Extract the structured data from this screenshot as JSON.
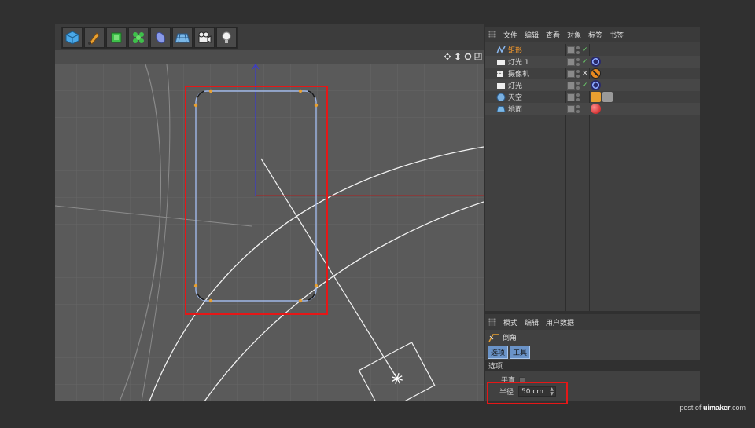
{
  "toolbar": {
    "icons": [
      "cube-icon",
      "pen-icon",
      "subdivision-icon",
      "cloner-icon",
      "deformer-icon",
      "floor-icon",
      "camera-icon",
      "light-icon"
    ]
  },
  "viewport": {
    "nav_icons": [
      "move-view-icon",
      "zoom-view-icon",
      "rotate-view-icon",
      "maximize-icon"
    ],
    "colors": {
      "spline": "#a0b8e8",
      "grid_bg": "#5a5a5a",
      "highlight": "#e51717",
      "point": "#e8a030"
    }
  },
  "object_manager": {
    "menu": [
      "文件",
      "编辑",
      "查看",
      "对象",
      "标签",
      "书签"
    ],
    "objects": [
      {
        "name": "矩形",
        "icon": "spline-icon",
        "active": true,
        "tags": []
      },
      {
        "name": "灯光 1",
        "icon": "light-icon",
        "active": false,
        "tags": [
          "target-tag-icon"
        ]
      },
      {
        "name": "摄像机",
        "icon": "camera-icon",
        "active": false,
        "tags": [
          "protection-tag-icon"
        ]
      },
      {
        "name": "灯光",
        "icon": "light-icon",
        "active": false,
        "tags": [
          "target-tag-icon"
        ]
      },
      {
        "name": "天空",
        "icon": "sky-icon",
        "active": false,
        "tags": [
          "hdr-tag-icon",
          "texture-tag-icon"
        ]
      },
      {
        "name": "地面",
        "icon": "floor-icon",
        "active": false,
        "tags": [
          "material-tag-icon"
        ]
      }
    ]
  },
  "attribute_manager": {
    "menu": [
      "模式",
      "编辑",
      "用户数据"
    ],
    "title": "倒角",
    "tabs": [
      "选项",
      "工具"
    ],
    "section": "选项",
    "flat_label": "平直",
    "radius_label": "半径",
    "radius_value": "50 cm"
  },
  "credit": {
    "prefix": "post of ",
    "site": "uimaker",
    "suffix": ".com"
  }
}
